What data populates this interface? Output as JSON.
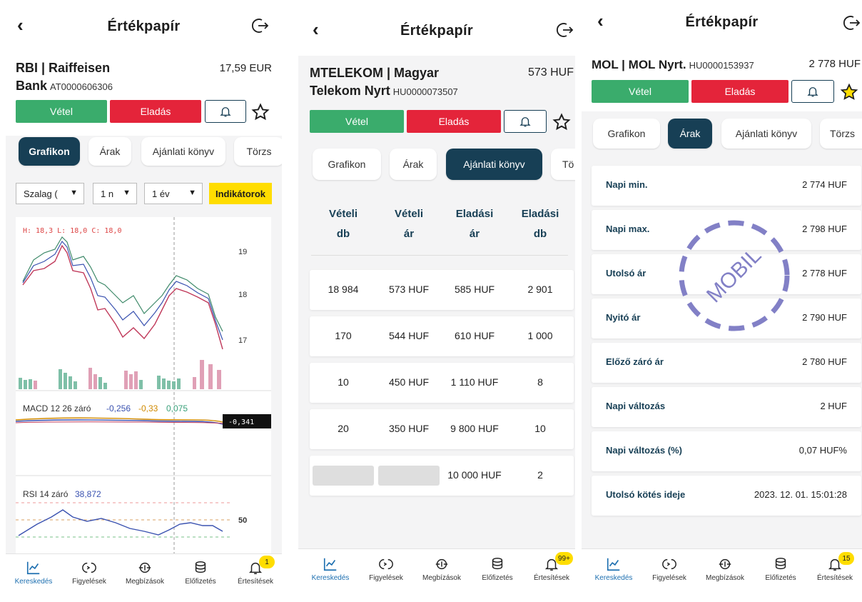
{
  "screens": [
    {
      "title": "Értékpapír",
      "security": {
        "name": "RBI | Raiffeisen Bank",
        "isin": "AT0000606306",
        "price": "17,59 EUR"
      },
      "buttons": {
        "buy": "Vétel",
        "sell": "Eladás"
      },
      "tabs": [
        "Grafikon",
        "Árak",
        "Ajánlati könyv",
        "Törzs"
      ],
      "active_tab": "Grafikon",
      "controls": {
        "chart_type": "Szalag (",
        "interval": "1 n",
        "range": "1 év",
        "indicators": "Indikátorok"
      },
      "chart": {
        "ohlc_label": "H: 18,3  L: 18,0  C: 18,0",
        "y_ticks": [
          "19",
          "18",
          "17"
        ],
        "macd_label": "MACD 12 26 záró",
        "macd_values": [
          "-0,256",
          "-0,33",
          "0,075"
        ],
        "macd_value_tag": "-0,341",
        "rsi_label": "RSI 14 záró",
        "rsi_value": "38,872",
        "rsi_tick": "50"
      },
      "nav": [
        {
          "label": "Kereskedés",
          "icon": "chart-line-icon"
        },
        {
          "label": "Figyelések",
          "icon": "watch-icon"
        },
        {
          "label": "Megbízások",
          "icon": "orders-icon"
        },
        {
          "label": "Előfizetés",
          "icon": "coins-icon"
        },
        {
          "label": "Értesítések",
          "icon": "bell-icon",
          "badge": "1"
        }
      ]
    },
    {
      "title": "Értékpapír",
      "security": {
        "name_line1": "MTELEKOM | Magyar",
        "name_line2": "Telekom Nyrt",
        "isin": "HU0000073507",
        "price": "573 HUF"
      },
      "buttons": {
        "buy": "Vétel",
        "sell": "Eladás"
      },
      "tabs": [
        "Grafikon",
        "Árak",
        "Ajánlati könyv",
        "Tö"
      ],
      "active_tab": "Ajánlati könyv",
      "orderbook": {
        "headers": [
          [
            "Vételi",
            "db"
          ],
          [
            "Vételi",
            "ár"
          ],
          [
            "Eladási",
            "ár"
          ],
          [
            "Eladási",
            "db"
          ]
        ],
        "rows": [
          [
            "18 984",
            "573 HUF",
            "585 HUF",
            "2 901"
          ],
          [
            "170",
            "544 HUF",
            "610 HUF",
            "1 000"
          ],
          [
            "10",
            "450 HUF",
            "1 110 HUF",
            "8"
          ],
          [
            "20",
            "350 HUF",
            "9 800 HUF",
            "10"
          ],
          [
            "",
            "",
            "10 000 HUF",
            "2"
          ]
        ]
      },
      "nav": [
        {
          "label": "Kereskedés",
          "icon": "chart-line-icon"
        },
        {
          "label": "Figyelések",
          "icon": "watch-icon"
        },
        {
          "label": "Megbízások",
          "icon": "orders-icon"
        },
        {
          "label": "Előfizetés",
          "icon": "coins-icon"
        },
        {
          "label": "Értesítések",
          "icon": "bell-icon",
          "badge": "99+"
        }
      ]
    },
    {
      "title": "Értékpapír",
      "security": {
        "name": "MOL | MOL Nyrt.",
        "isin": "HU0000153937",
        "price": "2 778 HUF"
      },
      "buttons": {
        "buy": "Vétel",
        "sell": "Eladás"
      },
      "tabs": [
        "Grafikon",
        "Árak",
        "Ajánlati könyv",
        "Törzs"
      ],
      "active_tab": "Árak",
      "prices": [
        {
          "label": "Napi min.",
          "value": "2 774 HUF"
        },
        {
          "label": "Napi max.",
          "value": "2 798 HUF"
        },
        {
          "label": "Utolsó ár",
          "value": "2 778 HUF"
        },
        {
          "label": "Nyitó ár",
          "value": "2 790 HUF"
        },
        {
          "label": "Előző záró ár",
          "value": "2 780 HUF"
        },
        {
          "label": "Napi változás",
          "value": "2 HUF"
        },
        {
          "label": "Napi változás (%)",
          "value": "0,07 HUF%"
        },
        {
          "label": "Utolsó kötés ideje",
          "value": "2023. 12. 01. 15:01:28"
        }
      ],
      "nav": [
        {
          "label": "Kereskedés",
          "icon": "chart-line-icon"
        },
        {
          "label": "Figyelések",
          "icon": "watch-icon"
        },
        {
          "label": "Megbízások",
          "icon": "orders-icon"
        },
        {
          "label": "Előfizetés",
          "icon": "coins-icon"
        },
        {
          "label": "Értesítések",
          "icon": "bell-icon",
          "badge": "15"
        }
      ]
    }
  ],
  "stamp": "MOBIL",
  "colors": {
    "buy": "#3aac6c",
    "sell": "#e4243a",
    "primary": "#173f55",
    "accent": "#ffdd00",
    "nav_active": "#1d6fb0"
  }
}
